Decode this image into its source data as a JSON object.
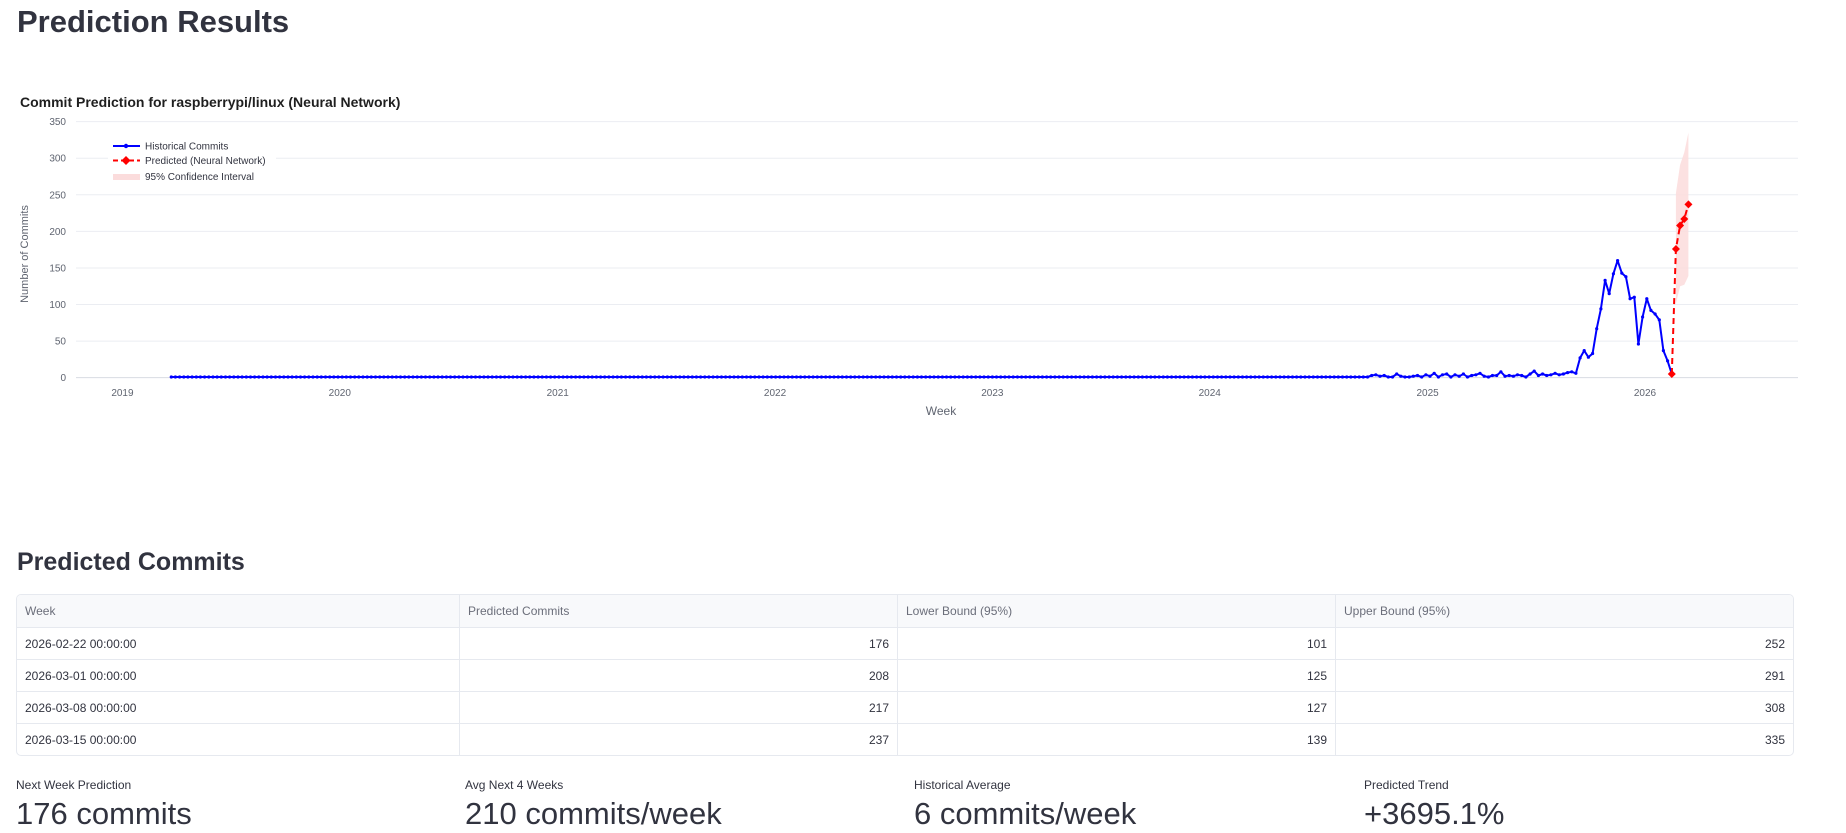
{
  "page": {
    "title": "Prediction Results",
    "table_title": "Predicted Commits"
  },
  "colors": {
    "historical": "#0000ff",
    "predicted": "#ff0000",
    "ci_fill": "#fbdcdc"
  },
  "chart_data": {
    "type": "line",
    "title": "Commit Prediction for raspberrypi/linux (Neural Network)",
    "xlabel": "Week",
    "ylabel": "Number of Commits",
    "ylim": [
      -10,
      355
    ],
    "yticks": [
      0,
      50,
      100,
      150,
      200,
      250,
      300,
      350
    ],
    "xlim": [
      "2018-10-15",
      "2026-09-15"
    ],
    "xticks": [
      "2019",
      "2020",
      "2021",
      "2022",
      "2023",
      "2024",
      "2025",
      "2026"
    ],
    "grid": true,
    "legend_position": "top-left",
    "historical": {
      "name": "Historical Commits",
      "start_date": "2019-03-24",
      "weekly_flat_until": "2024-09-22",
      "flat_value": 1,
      "points": [
        [
          "2024-09-22",
          1
        ],
        [
          "2024-09-29",
          3
        ],
        [
          "2024-10-06",
          4
        ],
        [
          "2024-10-13",
          2
        ],
        [
          "2024-10-20",
          3
        ],
        [
          "2024-10-27",
          1
        ],
        [
          "2024-11-03",
          1
        ],
        [
          "2024-11-10",
          5
        ],
        [
          "2024-11-17",
          2
        ],
        [
          "2024-11-24",
          1
        ],
        [
          "2024-12-01",
          1
        ],
        [
          "2024-12-08",
          2
        ],
        [
          "2024-12-15",
          3
        ],
        [
          "2024-12-22",
          1
        ],
        [
          "2024-12-29",
          4
        ],
        [
          "2025-01-05",
          2
        ],
        [
          "2025-01-12",
          6
        ],
        [
          "2025-01-19",
          1
        ],
        [
          "2025-01-26",
          4
        ],
        [
          "2025-02-02",
          5
        ],
        [
          "2025-02-09",
          1
        ],
        [
          "2025-02-16",
          4
        ],
        [
          "2025-02-23",
          2
        ],
        [
          "2025-03-02",
          5
        ],
        [
          "2025-03-09",
          1
        ],
        [
          "2025-03-16",
          3
        ],
        [
          "2025-03-23",
          4
        ],
        [
          "2025-03-30",
          6
        ],
        [
          "2025-04-06",
          2
        ],
        [
          "2025-04-13",
          1
        ],
        [
          "2025-04-20",
          3
        ],
        [
          "2025-04-27",
          3
        ],
        [
          "2025-05-04",
          8
        ],
        [
          "2025-05-11",
          2
        ],
        [
          "2025-05-18",
          3
        ],
        [
          "2025-05-25",
          2
        ],
        [
          "2025-06-01",
          4
        ],
        [
          "2025-06-08",
          3
        ],
        [
          "2025-06-15",
          1
        ],
        [
          "2025-06-22",
          5
        ],
        [
          "2025-06-29",
          9
        ],
        [
          "2025-07-06",
          3
        ],
        [
          "2025-07-13",
          5
        ],
        [
          "2025-07-20",
          3
        ],
        [
          "2025-07-27",
          4
        ],
        [
          "2025-08-03",
          6
        ],
        [
          "2025-08-10",
          4
        ],
        [
          "2025-08-17",
          5
        ],
        [
          "2025-08-24",
          7
        ],
        [
          "2025-08-31",
          8
        ],
        [
          "2025-09-07",
          6
        ],
        [
          "2025-09-14",
          27
        ],
        [
          "2025-09-21",
          37
        ],
        [
          "2025-09-28",
          28
        ],
        [
          "2025-10-05",
          33
        ],
        [
          "2025-10-12",
          67
        ],
        [
          "2025-10-19",
          94
        ],
        [
          "2025-10-26",
          133
        ],
        [
          "2025-11-02",
          115
        ],
        [
          "2025-11-09",
          142
        ],
        [
          "2025-11-16",
          160
        ],
        [
          "2025-11-23",
          143
        ],
        [
          "2025-11-30",
          138
        ],
        [
          "2025-12-07",
          108
        ],
        [
          "2025-12-14",
          110
        ],
        [
          "2025-12-21",
          46
        ],
        [
          "2025-12-28",
          83
        ],
        [
          "2026-01-04",
          108
        ],
        [
          "2026-01-11",
          92
        ],
        [
          "2026-01-18",
          87
        ],
        [
          "2026-01-25",
          79
        ],
        [
          "2026-02-01",
          37
        ],
        [
          "2026-02-08",
          23
        ],
        [
          "2026-02-15",
          5
        ]
      ]
    },
    "predicted": {
      "name": "Predicted (Neural Network)",
      "points": [
        [
          "2026-02-15",
          5
        ],
        [
          "2026-02-22",
          176
        ],
        [
          "2026-03-01",
          208
        ],
        [
          "2026-03-08",
          217
        ],
        [
          "2026-03-15",
          237
        ]
      ]
    },
    "confidence": {
      "name": "95% Confidence Interval",
      "lower": [
        [
          "2026-02-22",
          101
        ],
        [
          "2026-03-01",
          125
        ],
        [
          "2026-03-08",
          127
        ],
        [
          "2026-03-15",
          139
        ]
      ],
      "upper": [
        [
          "2026-02-22",
          252
        ],
        [
          "2026-03-01",
          291
        ],
        [
          "2026-03-08",
          308
        ],
        [
          "2026-03-15",
          335
        ]
      ]
    }
  },
  "table": {
    "headers": [
      "Week",
      "Predicted Commits",
      "Lower Bound (95%)",
      "Upper Bound (95%)"
    ],
    "rows": [
      [
        "2026-02-22 00:00:00",
        "176",
        "101",
        "252"
      ],
      [
        "2026-03-01 00:00:00",
        "208",
        "125",
        "291"
      ],
      [
        "2026-03-08 00:00:00",
        "217",
        "127",
        "308"
      ],
      [
        "2026-03-15 00:00:00",
        "237",
        "139",
        "335"
      ]
    ]
  },
  "metrics": [
    {
      "label": "Next Week Prediction",
      "value": "176 commits"
    },
    {
      "label": "Avg Next 4 Weeks",
      "value": "210 commits/week"
    },
    {
      "label": "Historical Average",
      "value": "6 commits/week"
    },
    {
      "label": "Predicted Trend",
      "value": "+3695.1%"
    }
  ]
}
